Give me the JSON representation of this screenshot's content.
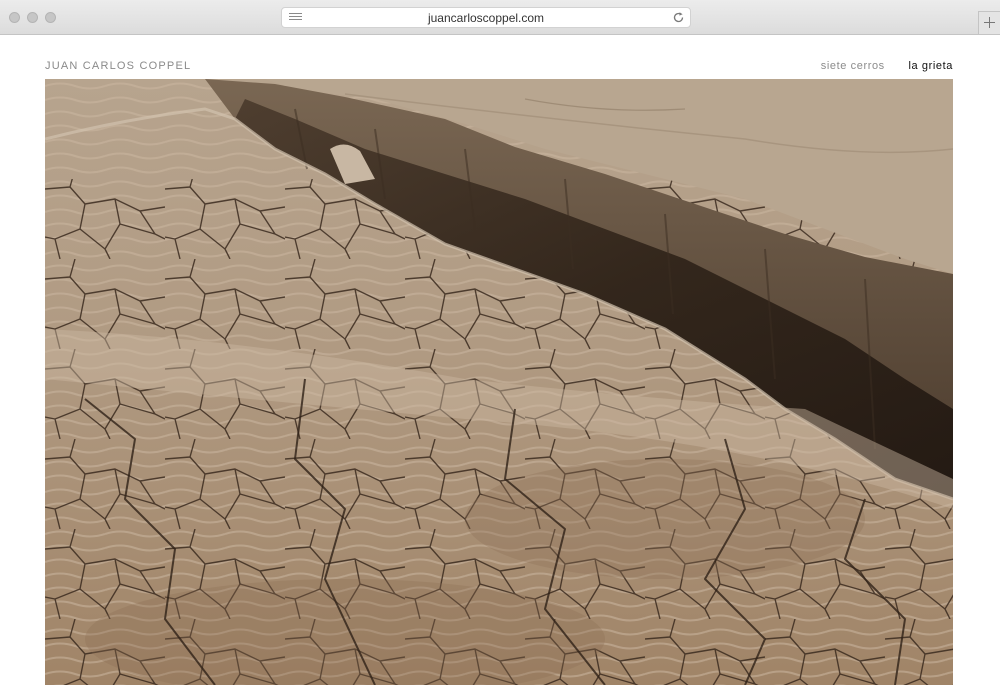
{
  "browser": {
    "url": "juancarloscoppel.com",
    "icons": [
      "reader-icon",
      "reload-icon",
      "new-tab-plus-icon"
    ]
  },
  "site": {
    "title": "JUAN CARLOS COPPEL",
    "nav": [
      {
        "label": "siete cerros",
        "active": false
      },
      {
        "label": "la grieta",
        "active": true
      }
    ]
  },
  "photo": {
    "subject": "cracked-dry-earth-with-deep-fissure",
    "palette": {
      "mud": "#a58d74",
      "mud_light": "#c4ad95",
      "crack": "#3a2a1e",
      "fissure_shadow": "#2b1f16",
      "far_ground": "#b9a58e"
    }
  }
}
